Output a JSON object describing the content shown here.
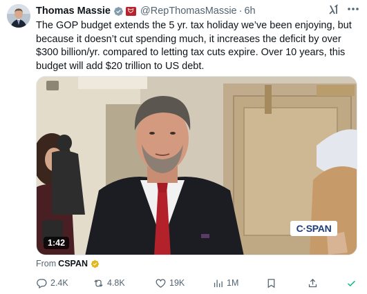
{
  "author": {
    "name": "Thomas Massie",
    "handle": "@RepThomasMassie",
    "separator": "·",
    "time": "6h"
  },
  "tweet": {
    "text": "The GOP budget extends the 5 yr. tax holiday we’ve been enjoying, but because it doesn’t cut spending much, it increases the deficit by over $300 billion/yr. compared to letting tax cuts expire. Over 10 years, this budget will add $20 trillion to US debt."
  },
  "media": {
    "duration": "1:42",
    "watermark": "C·SPAN"
  },
  "source": {
    "prefix": "From",
    "name": "CSPAN"
  },
  "actions": {
    "replies": "2.4K",
    "reposts": "4.8K",
    "likes": "19K",
    "views": "1M"
  },
  "icons": [
    "verified-badge-icon",
    "congress-flag-icon",
    "grok-icon",
    "more-icon",
    "gold-verified-icon",
    "reply-icon",
    "repost-icon",
    "like-icon",
    "views-icon",
    "bookmark-icon",
    "share-icon",
    "check-icon"
  ],
  "colors": {
    "text": "#0f1419",
    "secondary": "#536471",
    "verified_blue": "#1d9bf0",
    "gold": "#e2b719",
    "flag_red": "#b8232b",
    "check_green": "#00ba7c"
  }
}
